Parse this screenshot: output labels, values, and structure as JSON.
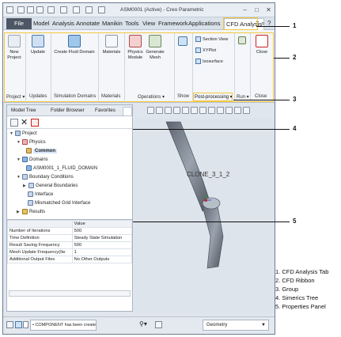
{
  "window": {
    "title": "ASM0001 (Active) - Creo Parametric",
    "minimize": "–",
    "maximize": "□",
    "close": "✕"
  },
  "menu": {
    "file": "File",
    "tabs": [
      "Model",
      "Analysis",
      "Annotate",
      "Manikin",
      "Tools",
      "View",
      "Framework",
      "Applications",
      "CFD Analysis"
    ]
  },
  "ribbon": {
    "buttons": {
      "new_project": "New Project",
      "update": "Update",
      "create_fluid_domain": "Create Fluid Domain",
      "materials": "Materials",
      "physics_module": "Physics Module",
      "generate_mesh": "Generate Mesh",
      "section_view": "Section View",
      "xyplot": "XYPlot",
      "isosurface": "Isosurface",
      "close": "Close"
    },
    "groups": [
      "Project ▾",
      "Updates",
      "Simulation Domains",
      "Materials",
      "Operations ▾",
      "Show",
      "Post-processing ▾",
      "Run ▾",
      "Close"
    ]
  },
  "panel": {
    "tabs": [
      "Model Tree",
      "Folder Browser",
      "Favorites"
    ],
    "tree": [
      {
        "label": "Project",
        "level": 0,
        "expanded": true
      },
      {
        "label": "Physics",
        "level": 1,
        "expanded": true
      },
      {
        "label": "Common",
        "level": 2,
        "selected": true
      },
      {
        "label": "Domains",
        "level": 1,
        "expanded": true
      },
      {
        "label": "ASM0001_1_FLUID_DOMAIN",
        "level": 2
      },
      {
        "label": "Boundary Conditions",
        "level": 1,
        "expanded": true
      },
      {
        "label": "General Boundaries",
        "level": 2
      },
      {
        "label": "Interface",
        "level": 2
      },
      {
        "label": "Mismatched Grid Interface",
        "level": 2
      },
      {
        "label": "Results",
        "level": 1
      }
    ],
    "properties": {
      "header": "Value",
      "rows": [
        {
          "name": "Number of Iterations",
          "value": "500"
        },
        {
          "name": "Time Definition",
          "value": "Steady State Simulation"
        },
        {
          "name": "Result Saving Frequency",
          "value": "500"
        },
        {
          "name": "Mesh Update Frequency(Ite",
          "value": "1"
        },
        {
          "name": "Additional Output Files",
          "value": "No Other Outputs"
        }
      ]
    }
  },
  "viewport": {
    "model_label": "CLONE_3_1_2"
  },
  "status": {
    "message": "• COMPONENT has been createc",
    "filter": "Geometry"
  },
  "callouts": [
    "1",
    "2",
    "3",
    "4",
    "5"
  ],
  "legend": [
    "1. CFD Analysis Tab",
    "2. CFD Ribbon",
    "3. Group",
    "4. Simerics Tree",
    "5. Properties Panel"
  ],
  "colors": {
    "highlight": "#f2c840",
    "file_tab": "#4d5664",
    "selection": "#d7e6f7"
  }
}
